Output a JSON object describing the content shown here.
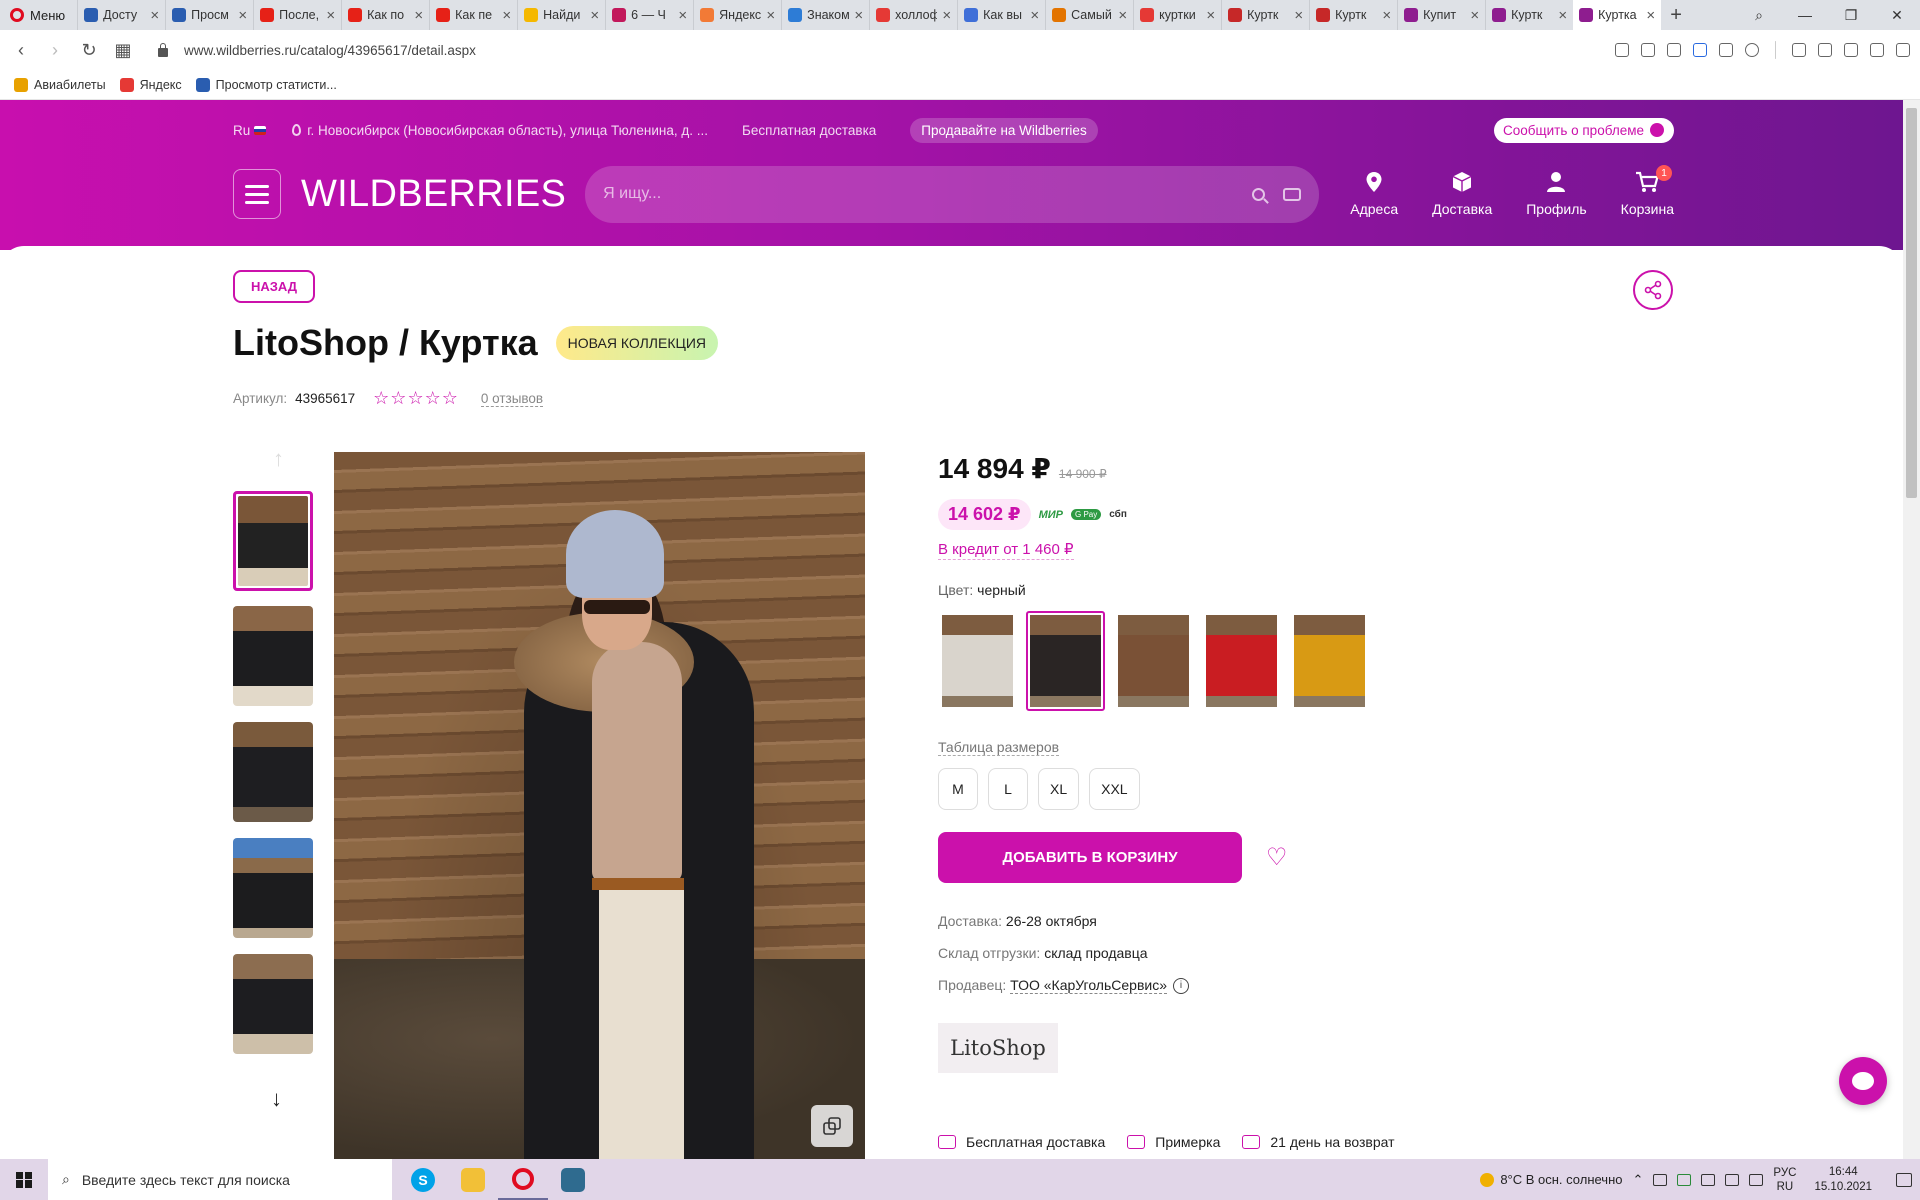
{
  "browser": {
    "menu_label": "Меню",
    "tabs": [
      {
        "title": "Досту",
        "color": "#2a5db0"
      },
      {
        "title": "Просм",
        "color": "#2a5db0"
      },
      {
        "title": "После,",
        "color": "#e62117"
      },
      {
        "title": "Как по",
        "color": "#e62117"
      },
      {
        "title": "Как пе",
        "color": "#e62117"
      },
      {
        "title": "Найди",
        "color": "#f5b800"
      },
      {
        "title": "6 — Ч",
        "color": "#c2185b"
      },
      {
        "title": "Яндекс",
        "color": "#f27a36"
      },
      {
        "title": "Знаком",
        "color": "#2d7cd6"
      },
      {
        "title": "холлоф",
        "color": "#e53935"
      },
      {
        "title": "Как вы",
        "color": "#3f6fd8"
      },
      {
        "title": "Самый",
        "color": "#e37400"
      },
      {
        "title": "куртки",
        "color": "#e53935"
      },
      {
        "title": "Куртк",
        "color": "#c62828"
      },
      {
        "title": "Куртк",
        "color": "#c62828"
      },
      {
        "title": "Купит",
        "color": "#8e1d8f"
      },
      {
        "title": "Куртк",
        "color": "#8e1d8f"
      },
      {
        "title": "Куртка",
        "color": "#8e1d8f",
        "active": true
      }
    ],
    "new_tab": "+",
    "url": "www.wildberries.ru/catalog/43965617/detail.aspx",
    "bookmarks": [
      {
        "label": "Авиабилеты",
        "color": "#e8a100"
      },
      {
        "label": "Яндекс",
        "color": "#e53935"
      },
      {
        "label": "Просмотр статисти...",
        "color": "#2a5db0"
      }
    ]
  },
  "header": {
    "lang": "Ru",
    "location": "г. Новосибирск (Новосибирская область), улица Тюленина, д. ...",
    "free_delivery": "Бесплатная доставка",
    "sell_label": "Продавайте на Wildberries",
    "report_label": "Сообщить о проблеме",
    "logo": "WILDBERRIES",
    "search_placeholder": "Я ищу...",
    "nav": [
      {
        "label": "Адреса",
        "icon": "pin-icon"
      },
      {
        "label": "Доставка",
        "icon": "box-icon"
      },
      {
        "label": "Профиль",
        "icon": "user-icon"
      },
      {
        "label": "Корзина",
        "icon": "cart-icon",
        "badge": "1"
      }
    ]
  },
  "product": {
    "back_label": "НАЗАД",
    "title": "LitoShop / Куртка",
    "badge": "НОВАЯ КОЛЛЕКЦИЯ",
    "article_label": "Артикул:",
    "article": "43965617",
    "stars": "☆☆☆☆☆",
    "reviews": "0 отзывов",
    "price": "14 894 ₽",
    "old_price": "14 900 ₽",
    "wallet_price": "14 602 ₽",
    "pay_mir": "МИР",
    "pay_gpay": "G Pay",
    "pay_sbp": "сбп",
    "credit": "В кредит от 1 460 ₽",
    "color_label": "Цвет:",
    "color_value": "черный",
    "color_swatches": [
      {
        "name": "white",
        "tone": "#d9d4cc"
      },
      {
        "name": "black",
        "tone": "#2a2524",
        "selected": true
      },
      {
        "name": "brown",
        "tone": "#7a5136"
      },
      {
        "name": "red",
        "tone": "#c91d22"
      },
      {
        "name": "yellow",
        "tone": "#d89a14"
      }
    ],
    "size_table": "Таблица размеров",
    "sizes": [
      "M",
      "L",
      "XL",
      "XXL"
    ],
    "add_to_cart": "ДОБАВИТЬ В КОРЗИНУ",
    "delivery_label": "Доставка:",
    "delivery_value": "26-28 октября",
    "warehouse_label": "Склад отгрузки:",
    "warehouse_value": "склад продавца",
    "seller_label": "Продавец:",
    "seller_value": "ТОО «КарУгольСервис»",
    "brand_logo": "LitoShop",
    "perks": [
      "Бесплатная доставка",
      "Примерка",
      "21 день на возврат"
    ]
  },
  "taskbar": {
    "search_placeholder": "Введите здесь текст для поиска",
    "weather": "8°C  В осн. солнечно",
    "lang_top": "РУС",
    "lang_bottom": "RU",
    "time": "16:44",
    "date": "15.10.2021"
  }
}
